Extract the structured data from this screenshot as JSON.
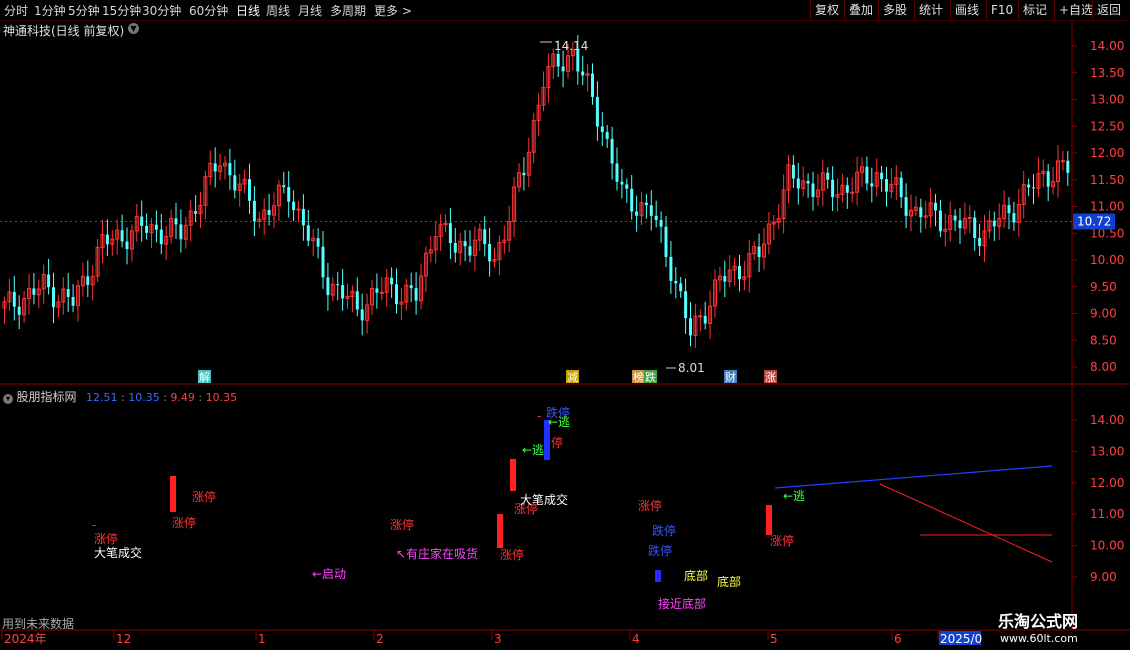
{
  "toolbar": {
    "periods": [
      "分时",
      "1分钟",
      "5分钟",
      "15分钟",
      "30分钟",
      "60分钟",
      "日线",
      "周线",
      "月线",
      "多周期",
      "更多"
    ],
    "active": "日线",
    "more_icon": "chevron-right-icon",
    "right": [
      "复权",
      "叠加",
      "多股",
      "统计",
      "画线",
      "F10",
      "标记",
      "+自选",
      "返回"
    ]
  },
  "stock": {
    "title": "神通科技(日线 前复权)",
    "current_price": "10.72"
  },
  "price_axis": {
    "labels": [
      "14.00",
      "13.50",
      "13.00",
      "12.50",
      "12.00",
      "11.50",
      "11.00",
      "10.50",
      "10.00",
      "9.50",
      "9.00",
      "8.50",
      "8.00"
    ]
  },
  "indicator": {
    "name": "股朋指标网",
    "values": [
      "12.51",
      "10.35",
      "9.49",
      "10.35"
    ]
  },
  "indicator_axis": {
    "labels": [
      "14.00",
      "13.00",
      "12.00",
      "11.00",
      "10.00",
      "9.00"
    ]
  },
  "events": [
    "解",
    "减",
    "榜",
    "跌",
    "财",
    "涨"
  ],
  "annotations": {
    "high": "14.14",
    "low": "8.01",
    "zt": "涨停",
    "dt": "跌停",
    "da_bi": "大笔成交",
    "qidong": "←启动",
    "xishou": "↖有庄家在吸货",
    "taopao": "←逃",
    "taopao2": "逃",
    "dibu": "底部",
    "jiejin": "接近底部",
    "dt_arrow": "跌停",
    "ting": "停",
    "dash": "-"
  },
  "time_axis": {
    "labels": [
      "2024年",
      "12",
      "1",
      "2",
      "3",
      "4",
      "5",
      "6",
      "2025/0"
    ]
  },
  "footer": {
    "future_note": "用到未来数据",
    "watermark": "乐淘公式网",
    "url": "www.60lt.com"
  },
  "colors": {
    "up": "#ff3333",
    "down": "#54ffff",
    "axis": "#8b0000",
    "grid": "#660000"
  }
}
